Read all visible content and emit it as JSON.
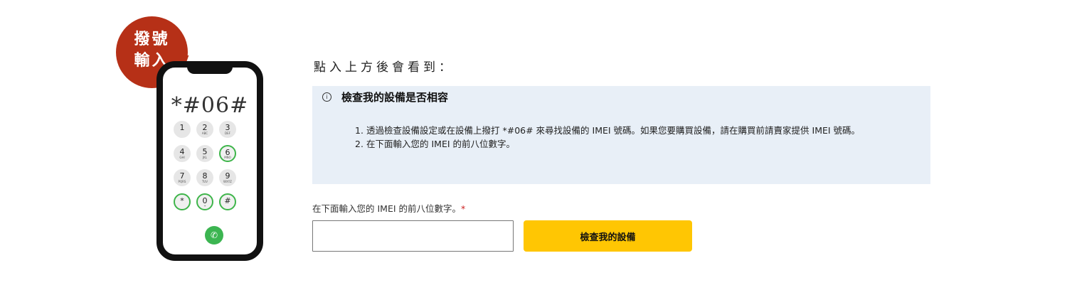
{
  "badge": {
    "line1": "撥號",
    "line2": "輸入"
  },
  "phone": {
    "display_code": "*#06#",
    "keys": [
      {
        "label": "1",
        "sub": ""
      },
      {
        "label": "2",
        "sub": "ABC"
      },
      {
        "label": "3",
        "sub": "DEF"
      },
      {
        "label": "4",
        "sub": "GHI"
      },
      {
        "label": "5",
        "sub": "JKL"
      },
      {
        "label": "6",
        "sub": "MNO"
      },
      {
        "label": "7",
        "sub": "PQRS"
      },
      {
        "label": "8",
        "sub": "TUV"
      },
      {
        "label": "9",
        "sub": "WXYZ"
      },
      {
        "label": "*",
        "sub": ""
      },
      {
        "label": "0",
        "sub": "+"
      },
      {
        "label": "#",
        "sub": ""
      }
    ],
    "highlighted_keys": [
      "6",
      "*",
      "0",
      "#"
    ],
    "call_icon": "phone-call-icon",
    "highlight_color": "#3eb54a"
  },
  "intro_text": "點入上方後會看到：",
  "info": {
    "icon": "info-circle-icon",
    "title": "檢查我的設備是否相容",
    "steps": [
      {
        "num": "1.",
        "text": "透過檢查設備設定或在設備上撥打 *#06# 來尋找設備的 IMEI 號碼。如果您要購買設備，請在購買前請賣家提供 IMEI 號碼。"
      },
      {
        "num": "2.",
        "text": "在下面輸入您的 IMEI 的前八位數字。"
      }
    ]
  },
  "form": {
    "label": "在下面輸入您的 IMEI 的前八位數字。",
    "required_mark": "*",
    "input_value": "",
    "input_placeholder": "",
    "button_label": "檢查我的設備"
  },
  "colors": {
    "badge": "#b63017",
    "info_background": "#e8eff7",
    "button": "#ffc603",
    "call_button": "#3cb551"
  }
}
